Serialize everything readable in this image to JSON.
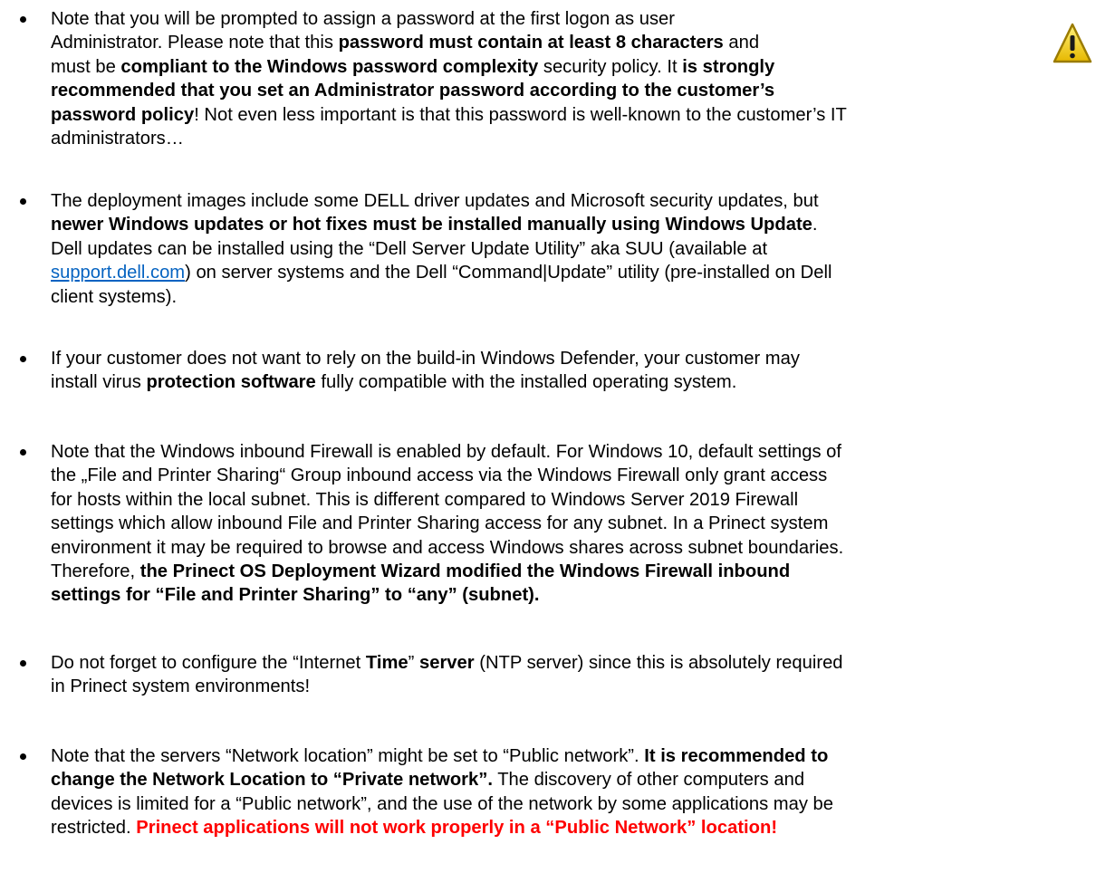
{
  "warning_icon": "warning-icon",
  "colors": {
    "link": "#0563c1",
    "emphasis_red": "#ff0000",
    "warning_yellow": "#f5d000"
  },
  "items": [
    {
      "l1": "Note that you will be prompted to assign a password at the first logon as user",
      "l2a": "Administrator. Please note that this ",
      "l2b": "password must contain at least 8 characters",
      "l2c": " and",
      "l3a": "must be ",
      "l3b": "compliant to the Windows password complexity",
      "l3c": " security policy. It ",
      "l3d": "is strongly",
      "l4": "recommended that you set an Administrator password according to the customer’s",
      "l5a": "password policy",
      "l5b": "! Not even less important is that this password is well-known to the customer’s IT",
      "l6": "administrators…"
    },
    {
      "l1": "The deployment images include some DELL driver updates and Microsoft security updates, but",
      "l2": "newer Windows updates or hot fixes must be installed manually using Windows Update",
      "l2end": ".",
      "l3": "Dell updates can be installed using the “Dell Server Update Utility” aka SUU (available at",
      "l4link": "support.dell.com",
      "l4rest": ") on server systems and the Dell “Command|Update” utility (pre-installed on Dell",
      "l5": "client systems)."
    },
    {
      "l1": "If your customer does not want to rely on the build-in Windows Defender, your customer may",
      "l2a": "install virus ",
      "l2b": "protection software",
      "l2c": " fully compatible with the installed operating system."
    },
    {
      "l1": "Note that the Windows inbound Firewall is enabled by default. For Windows 10, default settings of",
      "l2": "the „File and Printer Sharing“ Group inbound access via the Windows Firewall only grant access",
      "l3": "for hosts within the local subnet. This is different compared to Windows Server 2019 Firewall",
      "l4": "settings which allow inbound File and Printer Sharing access for any subnet. In a Prinect system",
      "l5": "environment it may be required to browse and access Windows shares across subnet boundaries.",
      "l6a": "Therefore, ",
      "l6b": "the Prinect OS Deployment Wizard modified the Windows Firewall inbound",
      "l7": "settings for “File and Printer Sharing” to “any” (subnet)."
    },
    {
      "l1a": "Do not forget to configure the “Internet ",
      "l1b": "Time",
      "l1c": "” ",
      "l1d": "server",
      "l1e": " (NTP server) since this is absolutely required",
      "l2": "in Prinect system environments!"
    },
    {
      "l1a": "Note that the servers “Network location” might be set to “Public network”. ",
      "l1b": "It is recommended to",
      "l2": "change the Network Location to “Private network”.",
      "l2b": " The discovery of other computers and",
      "l3": "devices is limited for a “Public network”, and the use of the network by some applications may be",
      "l4a": "restricted. ",
      "l4b": "Prinect applications will not work properly in a “Public Network” location!"
    }
  ]
}
